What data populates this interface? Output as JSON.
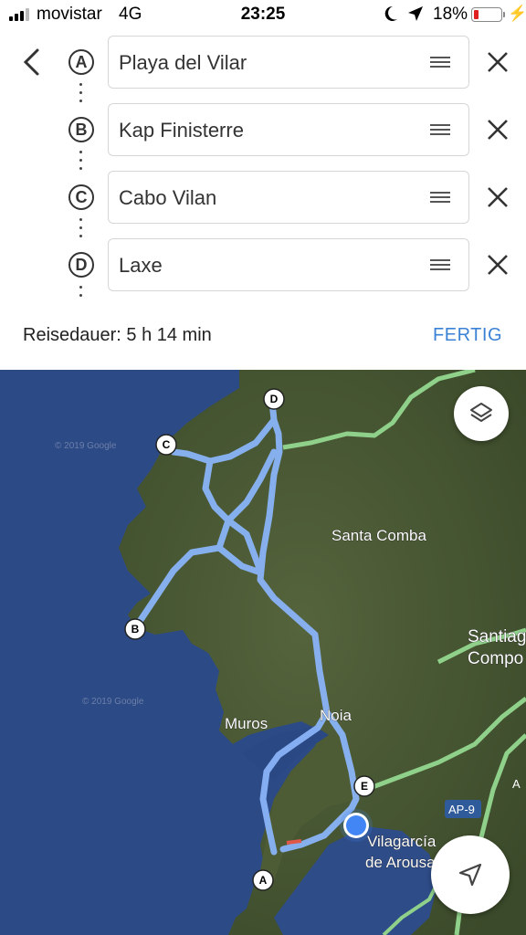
{
  "status_bar": {
    "carrier": "movistar",
    "network": "4G",
    "time": "23:25",
    "battery_percent": "18%",
    "battery_level": 0.18,
    "signal_bars": 3
  },
  "route": {
    "stops": [
      {
        "badge": "A",
        "name": "Playa del Vilar"
      },
      {
        "badge": "B",
        "name": "Kap Finisterre"
      },
      {
        "badge": "C",
        "name": "Cabo Vilan"
      },
      {
        "badge": "D",
        "name": "Laxe"
      }
    ],
    "duration": "Reisedauer: 5 h 14 min",
    "done_label": "FERTIG"
  },
  "map": {
    "labels": {
      "santa_comba": "Santa Comba",
      "santiago_1": "Santiag",
      "santiago_2": "Compo",
      "muros": "Muros",
      "noia": "Noia",
      "vilagarcia_1": "Vilagarcía",
      "vilagarcia_2": "de Arousa",
      "road_ap9": "AP-9",
      "road_a": "A"
    },
    "watermarks": [
      "© 2019 Google",
      "© 2019 Google"
    ],
    "markers": [
      "A",
      "B",
      "C",
      "D",
      "E"
    ]
  },
  "colors": {
    "accent": "#3b82d6",
    "route": "#8ab4f8",
    "highway": "#8fd18a",
    "water": "#2c4a86",
    "land": "#4a5a34"
  }
}
